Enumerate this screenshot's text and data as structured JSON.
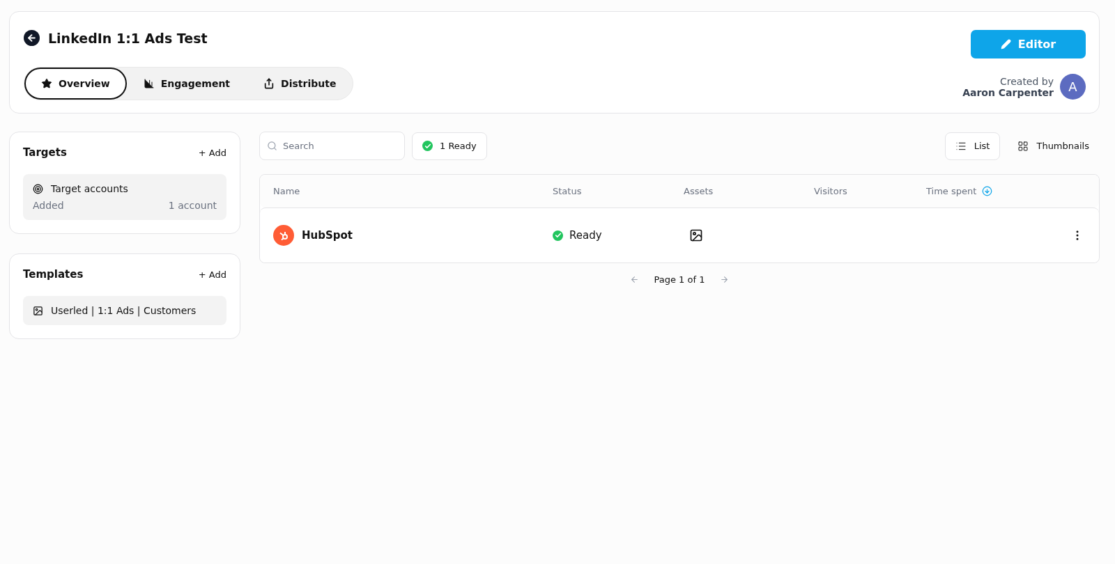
{
  "header": {
    "title": "LinkedIn 1:1 Ads Test",
    "editor_button": "Editor",
    "created_by_label": "Created by",
    "creator": "Aaron Carpenter",
    "avatar_initial": "A"
  },
  "tabs": [
    {
      "label": "Overview",
      "selected": true
    },
    {
      "label": "Engagement",
      "selected": false
    },
    {
      "label": "Distribute",
      "selected": false
    }
  ],
  "sidebar": [
    {
      "title": "Targets",
      "add": "+ Add",
      "items": [
        {
          "kind": "target",
          "label": "Target accounts",
          "status": "Added",
          "count": "1 account"
        }
      ]
    },
    {
      "title": "Templates",
      "add": "+ Add",
      "items": [
        {
          "kind": "template",
          "label": "Userled | 1:1 Ads | Customers"
        }
      ]
    }
  ],
  "search": {
    "placeholder": "Search"
  },
  "filter": {
    "label": "1 Ready",
    "color": "#22c55e"
  },
  "views": [
    {
      "label": "List",
      "selected": true
    },
    {
      "label": "Thumbnails",
      "selected": false
    }
  ],
  "table": {
    "columns": [
      {
        "label": "Name",
        "sorted": false
      },
      {
        "label": "Status",
        "sorted": false
      },
      {
        "label": "Assets",
        "sorted": false
      },
      {
        "label": "Visitors",
        "sorted": false
      },
      {
        "label": "Time spent",
        "sorted": true
      }
    ],
    "rows": [
      {
        "name": "HubSpot",
        "status": "Ready"
      }
    ]
  },
  "pagination": {
    "label": "Page 1 of 1"
  }
}
